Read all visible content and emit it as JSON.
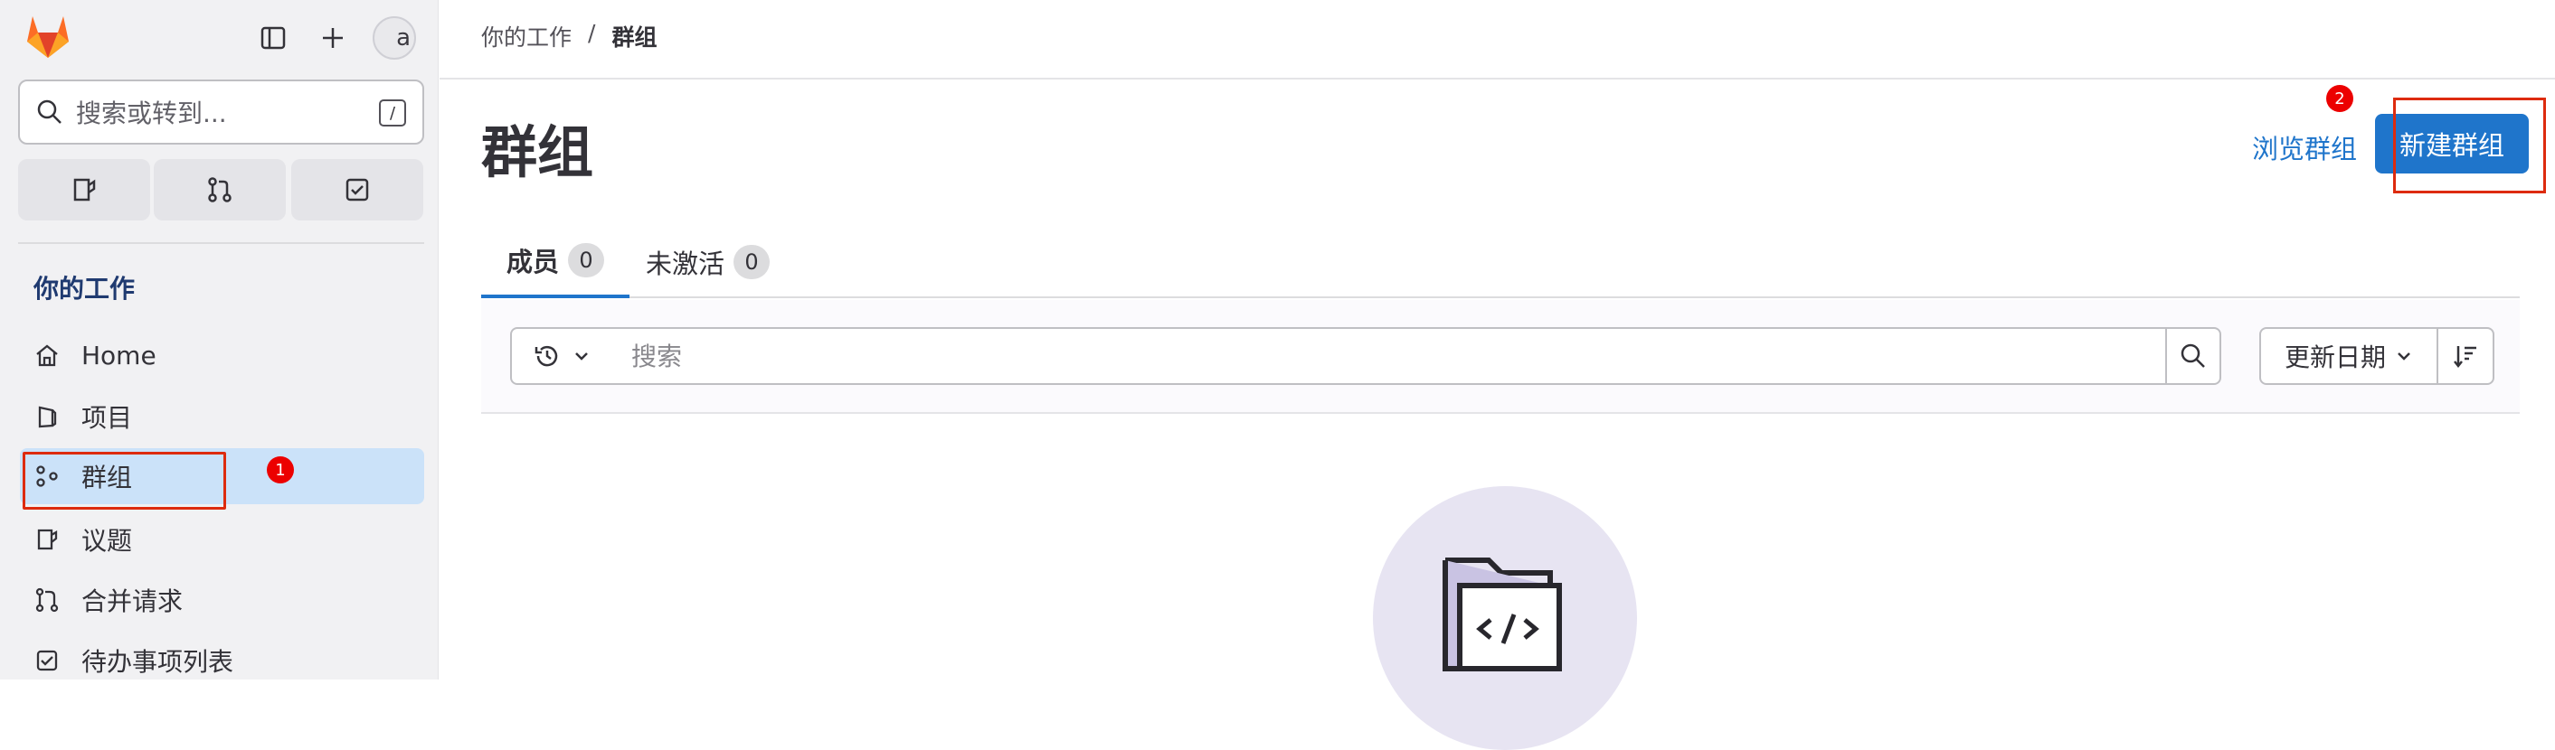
{
  "sidebar": {
    "logo_icon": "gitlab-tanuki-logo",
    "search_placeholder": "搜索或转到...",
    "search_shortcut": "/",
    "avatar_alt": "a",
    "section_title": "你的工作",
    "items": [
      {
        "label": "Home",
        "icon": "home-icon"
      },
      {
        "label": "项目",
        "icon": "project-icon"
      },
      {
        "label": "群组",
        "icon": "group-icon",
        "active": true
      },
      {
        "label": "议题",
        "icon": "issues-icon"
      },
      {
        "label": "合并请求",
        "icon": "merge-request-icon"
      },
      {
        "label": "待办事项列表",
        "icon": "todo-icon"
      }
    ],
    "annotation": "1"
  },
  "breadcrumb": {
    "parent": "你的工作",
    "separator": "/",
    "current": "群组"
  },
  "header": {
    "title": "群组",
    "explore_link": "浏览群组",
    "new_group_button": "新建群组",
    "annotation": "2"
  },
  "tabs": [
    {
      "label": "成员",
      "count": "0",
      "active": true
    },
    {
      "label": "未激活",
      "count": "0",
      "active": false
    }
  ],
  "filter": {
    "search_placeholder": "搜索",
    "sort_label": "更新日期"
  },
  "colors": {
    "accent": "#1f75cb",
    "sidebar_bg": "#f1f1f3",
    "active_nav": "#cbe2f9",
    "annotation_red": "#dd2b0e",
    "empty_state_circle": "#e7e4f2"
  }
}
